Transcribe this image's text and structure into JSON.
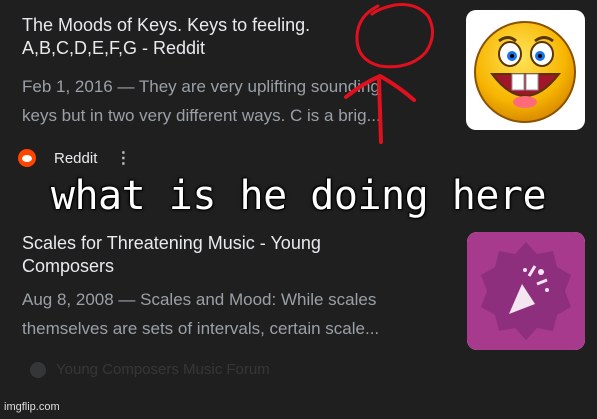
{
  "results": [
    {
      "title": "The Moods of Keys. Keys to feeling. A,B,C,D,E,F,G - Reddit",
      "snippet_line1": "Feb 1, 2016 — They are very uplifting sounding",
      "snippet_line2": "keys but in two very different ways. C is a brig...",
      "thumbnail_icon": "laughing-emoji-icon",
      "source_name": "Reddit",
      "source_icon": "reddit-logo-icon"
    },
    {
      "title": "Scales for Threatening Music - Young Composers",
      "snippet_line1": "Aug 8, 2008 — Scales and Mood: While scales",
      "snippet_line2": "themselves are sets of intervals, certain scale...",
      "thumbnail_icon": "party-popper-badge-icon",
      "source_name": "Young Composers Music Forum"
    }
  ],
  "meme": {
    "caption": "what is he doing here",
    "watermark": "imgflip.com",
    "annotation_color": "#e0101e"
  },
  "colors": {
    "background": "#1f1f1f",
    "title_text": "#e8eaed",
    "snippet_text": "#9aa0a6",
    "reddit": "#ff4500",
    "badge": "#8e2f7e"
  }
}
